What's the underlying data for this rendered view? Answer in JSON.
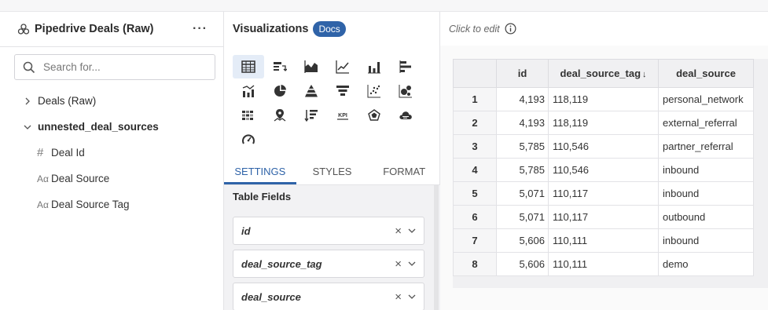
{
  "dataset": {
    "title": "Pipedrive Deals (Raw)",
    "more_label": "···",
    "search_placeholder": "Search for...",
    "tree": [
      {
        "label": "Deals (Raw)",
        "expanded": false
      },
      {
        "label": "unnested_deal_sources",
        "expanded": true
      }
    ],
    "fields": [
      {
        "type": "#",
        "label": "Deal Id"
      },
      {
        "type": "Aα",
        "label": "Deal Source"
      },
      {
        "type": "Aα",
        "label": "Deal Source Tag"
      }
    ]
  },
  "visualizations": {
    "title": "Visualizations",
    "docs_label": "Docs",
    "kpi_label": "KPI",
    "icons": [
      "table-icon",
      "pivot-table-icon",
      "area-chart-icon",
      "line-chart-icon",
      "bar-chart-icon",
      "horizontal-bar-icon",
      "combo-chart-icon",
      "pie-chart-icon",
      "pyramid-icon",
      "funnel-icon",
      "scatter-icon",
      "bubble-icon",
      "heatmap-icon",
      "map-icon",
      "sorted-bar-icon",
      "kpi-icon",
      "radar-icon",
      "word-cloud-icon",
      "gauge-icon"
    ],
    "active_icon": "table-icon",
    "tabs": [
      "SETTINGS",
      "STYLES",
      "FORMAT"
    ],
    "active_tab": "SETTINGS",
    "section_label": "Table Fields",
    "pills": [
      "id",
      "deal_source_tag",
      "deal_source"
    ]
  },
  "result": {
    "edit_label": "Click to edit",
    "columns": [
      "id",
      "deal_source_tag",
      "deal_source"
    ],
    "sort_indicator": "↓",
    "rows": [
      {
        "n": "1",
        "id": "4,193",
        "tag": "118,119",
        "source": "personal_network"
      },
      {
        "n": "2",
        "id": "4,193",
        "tag": "118,119",
        "source": "external_referral"
      },
      {
        "n": "3",
        "id": "5,785",
        "tag": "110,546",
        "source": "partner_referral"
      },
      {
        "n": "4",
        "id": "5,785",
        "tag": "110,546",
        "source": "inbound"
      },
      {
        "n": "5",
        "id": "5,071",
        "tag": "110,117",
        "source": "inbound"
      },
      {
        "n": "6",
        "id": "5,071",
        "tag": "110,117",
        "source": "outbound"
      },
      {
        "n": "7",
        "id": "5,606",
        "tag": "110,111",
        "source": "inbound"
      },
      {
        "n": "8",
        "id": "5,606",
        "tag": "110,111",
        "source": "demo"
      }
    ]
  },
  "colors": {
    "accent": "#2f63a8",
    "border": "#e3e3e6"
  }
}
